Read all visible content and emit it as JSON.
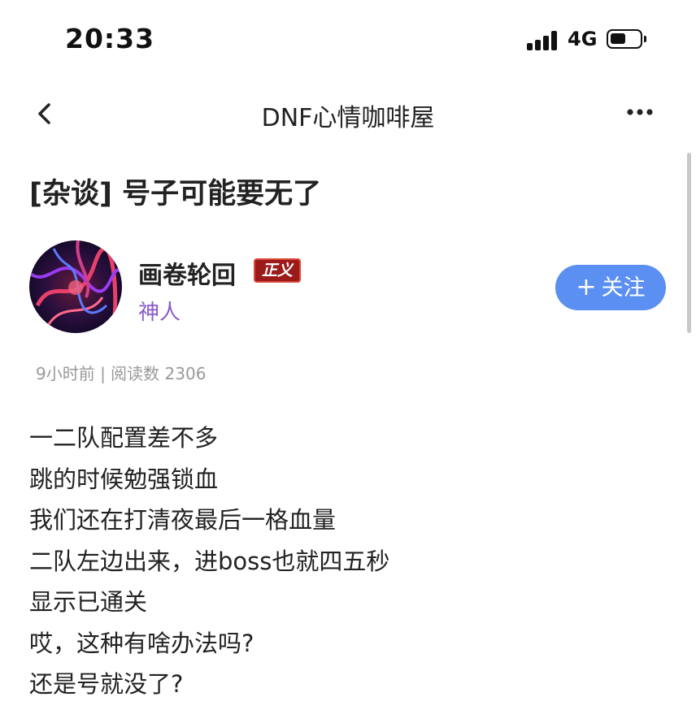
{
  "status_bar": {
    "time": "20:33",
    "network": "4G",
    "signal_bars": 4,
    "battery_level": 0.5
  },
  "nav": {
    "title": "DNF心情咖啡屋",
    "back_icon": "chevron-left-icon",
    "more_icon": "more-horizontal-icon"
  },
  "post": {
    "title": "[杂谈] 号子可能要无了",
    "author": {
      "name": "画卷轮回",
      "badge": "正义",
      "rank": "神人"
    },
    "follow_label": "关注",
    "meta": "9小时前 | 阅读数 2306",
    "body_lines": [
      "一二队配置差不多",
      "跳的时候勉强锁血",
      "我们还在打清夜最后一格血量",
      "二队左边出来，进boss也就四五秒",
      "显示已通关",
      "哎，这种有啥办法吗?",
      "还是号就没了?"
    ]
  },
  "colors": {
    "follow_button": "#5b8ff2",
    "badge": "#9b1a1a",
    "rank_text": "#8a5ac8",
    "meta_text": "#999999"
  }
}
